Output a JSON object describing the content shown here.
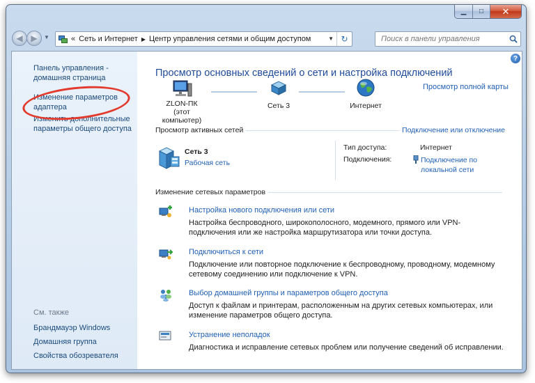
{
  "window": {
    "buttons": {
      "minimize": "▁",
      "maximize": "□",
      "close": "✕"
    }
  },
  "address_bar": {
    "prefix": "«",
    "crumbs": [
      "Сеть и Интернет",
      "Центр управления сетями и общим доступом"
    ],
    "refresh_icon": "refresh-icon"
  },
  "search": {
    "placeholder": "Поиск в панели управления"
  },
  "sidebar": {
    "home_link": "Панель управления - домашняя страница",
    "adapter_link": "Изменение параметров адаптера",
    "sharing_link": "Изменить дополнительные параметры общего доступа",
    "see_also": "См. также",
    "firewall": "Брандмауэр Windows",
    "homegroup": "Домашняя группа",
    "browser_props": "Свойства обозревателя"
  },
  "main": {
    "title": "Просмотр основных сведений о сети и настройка подключений",
    "full_map_link": "Просмотр полной карты",
    "map": {
      "computer": "ZLON-ПК",
      "computer_sub": "(этот компьютер)",
      "network": "Сеть  3",
      "internet": "Интернет"
    },
    "active_header": "Просмотр активных сетей",
    "connect_toggle": "Подключение или отключение",
    "active": {
      "name": "Сеть  3",
      "type": "Рабочая сеть",
      "access_label": "Тип доступа:",
      "access_value": "Интернет",
      "conn_label": "Подключения:",
      "conn_value": "Подключение по локальной сети"
    },
    "change_header": "Изменение сетевых параметров",
    "tasks": [
      {
        "title": "Настройка нового подключения или сети",
        "desc": "Настройка беспроводного, широкополосного, модемного, прямого или VPN-подключения или же настройка маршрутизатора или точки доступа."
      },
      {
        "title": "Подключиться к сети",
        "desc": "Подключение или повторное подключение к беспроводному, проводному, модемному сетевому соединению или подключение к VPN."
      },
      {
        "title": "Выбор домашней группы и параметров общего доступа",
        "desc": "Доступ к файлам и принтерам, расположенным на других сетевых компьютерах, или изменение параметров общего доступа."
      },
      {
        "title": "Устранение неполадок",
        "desc": "Диагностика и исправление сетевых проблем или получение сведений об исправлении."
      }
    ]
  },
  "colors": {
    "link": "#1f5fb5",
    "title": "#1f4b9b",
    "highlight": "#e23a2c"
  }
}
